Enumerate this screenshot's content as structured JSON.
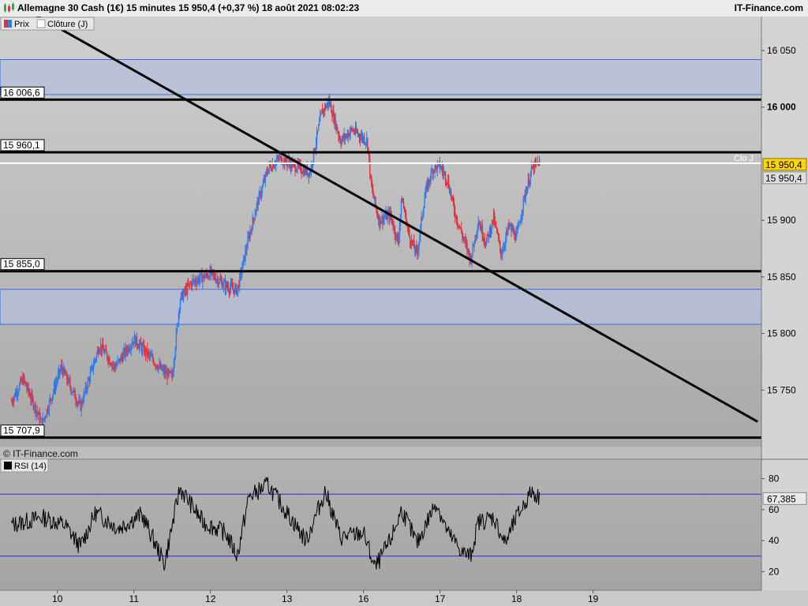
{
  "header": {
    "title": "Allemagne 30 Cash (1€) 15 minutes 15 950,4 (+0,37 %) 18 août 2021 08:02:23",
    "brand": "IT-Finance.com"
  },
  "legend": {
    "price": "Prix",
    "close": "Clôture (J)",
    "rsi": "RSI (14)"
  },
  "watermark": "© IT-Finance.com",
  "close_line_label": "Clo J",
  "colors": {
    "bull": "#2f7df0",
    "bear": "#e0303a",
    "level": "#000000",
    "close": "#ffffff",
    "rsi": "#000000",
    "rsi_band": "#2b2bd6",
    "zone": "#b6bedb",
    "current_price_bg": "#ffd700"
  },
  "chart_data": [
    {
      "type": "candlestick",
      "title": "Allemagne 30 Cash (1€) 15 minutes",
      "x_ticks": [
        "10",
        "11",
        "12",
        "13",
        "16",
        "17",
        "18",
        "19"
      ],
      "y_ticks": [
        "16 050",
        "16 000",
        "15 900",
        "15 850",
        "15 800",
        "15 750"
      ],
      "ylim": [
        15700,
        16080
      ],
      "current_price": "15 950,4",
      "previous_close": "15 950,4",
      "horizontal_levels": [
        {
          "label": "16 006,6",
          "value": 16006.6
        },
        {
          "label": "15 960,1",
          "value": 15960.1
        },
        {
          "label": "15 855,0",
          "value": 15855.0
        },
        {
          "label": "15 707,9",
          "value": 15707.9
        }
      ],
      "zones": [
        {
          "from": 16011,
          "to": 16042
        },
        {
          "from": 15808,
          "to": 15839
        }
      ],
      "trendline": {
        "from": {
          "x": 9.7,
          "y": 16082
        },
        "to": {
          "x": 19.15,
          "y": 15722
        }
      },
      "series": [
        {
          "anchors": [
            [
              9.4,
              15740
            ],
            [
              9.55,
              15760
            ],
            [
              9.8,
              15720
            ],
            [
              10.05,
              15770
            ],
            [
              10.3,
              15735
            ],
            [
              10.55,
              15790
            ],
            [
              10.75,
              15770
            ],
            [
              11.0,
              15795
            ],
            [
              11.2,
              15780
            ],
            [
              11.4,
              15765
            ],
            [
              11.5,
              15762
            ],
            [
              11.6,
              15830
            ],
            [
              11.75,
              15845
            ],
            [
              12.0,
              15853
            ],
            [
              12.2,
              15842
            ],
            [
              12.35,
              15838
            ],
            [
              12.5,
              15885
            ],
            [
              12.6,
              15912
            ],
            [
              12.75,
              15945
            ],
            [
              12.9,
              15955
            ],
            [
              13.1,
              15948
            ],
            [
              13.3,
              15942
            ],
            [
              13.45,
              15995
            ],
            [
              13.55,
              16005
            ],
            [
              13.7,
              15970
            ],
            [
              13.85,
              15980
            ],
            [
              14.05,
              15970
            ],
            [
              14.1,
              15930
            ],
            [
              14.2,
              15900
            ],
            [
              14.35,
              15905
            ],
            [
              14.45,
              15880
            ],
            [
              14.5,
              15920
            ],
            [
              14.6,
              15885
            ],
            [
              14.7,
              15870
            ],
            [
              14.8,
              15922
            ],
            [
              14.9,
              15945
            ],
            [
              15.0,
              15948
            ],
            [
              15.1,
              15935
            ],
            [
              15.2,
              15905
            ],
            [
              15.3,
              15885
            ],
            [
              15.4,
              15865
            ],
            [
              15.5,
              15900
            ],
            [
              15.6,
              15880
            ],
            [
              15.7,
              15902
            ],
            [
              15.8,
              15870
            ],
            [
              15.9,
              15895
            ],
            [
              16.0,
              15885
            ],
            [
              16.1,
              15920
            ],
            [
              16.2,
              15945
            ],
            [
              16.3,
              15952
            ]
          ]
        }
      ]
    },
    {
      "type": "line",
      "title": "RSI (14)",
      "ylim": [
        10,
        90
      ],
      "y_ticks": [
        "80",
        "60",
        "40",
        "20"
      ],
      "bands": [
        70,
        30
      ],
      "current_value": "67,385",
      "series": [
        {
          "name": "RSI (14)",
          "anchors": [
            [
              9.4,
              50
            ],
            [
              9.8,
              55
            ],
            [
              10.1,
              50
            ],
            [
              10.3,
              36
            ],
            [
              10.5,
              58
            ],
            [
              10.8,
              48
            ],
            [
              11.1,
              57
            ],
            [
              11.4,
              25
            ],
            [
              11.6,
              74
            ],
            [
              11.9,
              52
            ],
            [
              12.2,
              45
            ],
            [
              12.35,
              30
            ],
            [
              12.5,
              68
            ],
            [
              12.75,
              76
            ],
            [
              13.0,
              58
            ],
            [
              13.25,
              40
            ],
            [
              13.5,
              72
            ],
            [
              13.7,
              42
            ],
            [
              14.0,
              45
            ],
            [
              14.15,
              22
            ],
            [
              14.35,
              40
            ],
            [
              14.5,
              60
            ],
            [
              14.7,
              38
            ],
            [
              14.95,
              65
            ],
            [
              15.1,
              45
            ],
            [
              15.3,
              32
            ],
            [
              15.4,
              30
            ],
            [
              15.5,
              52
            ],
            [
              15.7,
              55
            ],
            [
              15.85,
              38
            ],
            [
              16.0,
              55
            ],
            [
              16.2,
              72
            ],
            [
              16.3,
              67.4
            ]
          ]
        }
      ]
    }
  ]
}
